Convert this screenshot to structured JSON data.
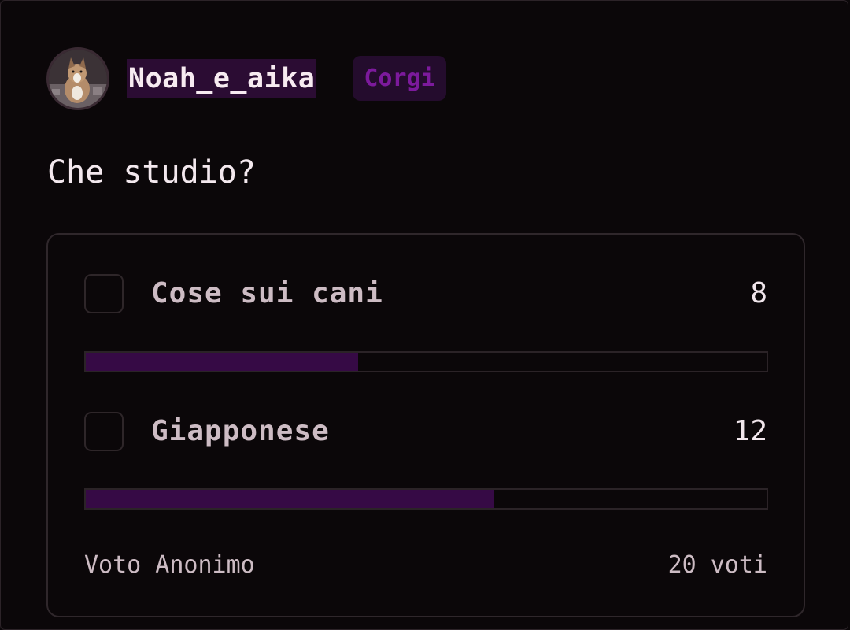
{
  "post": {
    "username": "Noah_e_aika",
    "tag": "Corgi",
    "question": "Che studio?"
  },
  "poll": {
    "options": [
      {
        "label": "Cose sui cani",
        "votes": "8",
        "fraction": 0.4
      },
      {
        "label": "Giapponese",
        "votes": "12",
        "fraction": 0.6
      }
    ],
    "footer_left": "Voto Anonimo",
    "footer_right": "20 voti"
  },
  "colors": {
    "background": "#0b0709",
    "accent": "#360a45",
    "tag_text": "#7c1a9c",
    "username_highlight": "#2b0c33"
  },
  "icons": {
    "avatar": "dog-photo-avatar",
    "checkbox": "empty-checkbox"
  }
}
